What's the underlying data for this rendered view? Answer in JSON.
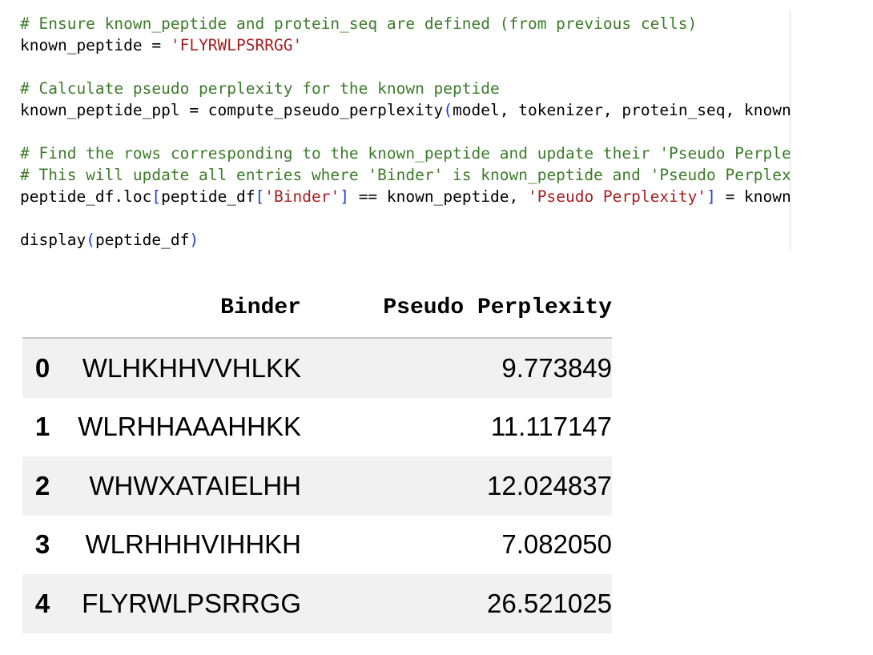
{
  "code_cell": {
    "lines": [
      [
        {
          "t": "# Ensure known_peptide and protein_seq are defined (from previous cells)",
          "c": "cm"
        }
      ],
      [
        {
          "t": "known_peptide = ",
          "c": ""
        },
        {
          "t": "'FLYRWLPSRRGG'",
          "c": "st"
        }
      ],
      [],
      [
        {
          "t": "# Calculate pseudo perplexity for the known peptide",
          "c": "cm"
        }
      ],
      [
        {
          "t": "known_peptide_ppl = compute_pseudo_perplexity",
          "c": ""
        },
        {
          "t": "(",
          "c": "pb"
        },
        {
          "t": "model, tokenizer, protein_seq, known_pept",
          "c": ""
        }
      ],
      [],
      [
        {
          "t": "# Find the rows corresponding to the known_peptide and update their 'Pseudo Perplexity'",
          "c": "cm"
        }
      ],
      [
        {
          "t": "# This will update all entries where 'Binder' is known_peptide and 'Pseudo Perplexity'",
          "c": "cm"
        }
      ],
      [
        {
          "t": "peptide_df.loc",
          "c": ""
        },
        {
          "t": "[",
          "c": "pb"
        },
        {
          "t": "peptide_df",
          "c": ""
        },
        {
          "t": "[",
          "c": "pb"
        },
        {
          "t": "'Binder'",
          "c": "st"
        },
        {
          "t": "]",
          "c": "pb"
        },
        {
          "t": " == known_peptide, ",
          "c": ""
        },
        {
          "t": "'Pseudo Perplexity'",
          "c": "st"
        },
        {
          "t": "]",
          "c": "pb"
        },
        {
          "t": " = known_pept",
          "c": ""
        }
      ],
      [],
      [
        {
          "t": "display",
          "c": ""
        },
        {
          "t": "(",
          "c": "pb"
        },
        {
          "t": "peptide_df",
          "c": ""
        },
        {
          "t": ")",
          "c": "pb"
        }
      ]
    ]
  },
  "dataframe": {
    "columns": [
      "",
      "Binder",
      "Pseudo Perplexity"
    ],
    "rows": [
      {
        "index": "0",
        "binder": "WLHKHHVVHLKK",
        "ppl": "9.773849"
      },
      {
        "index": "1",
        "binder": "WLRHHAAAHHKK",
        "ppl": "11.117147"
      },
      {
        "index": "2",
        "binder": "WHWXATAIELHH",
        "ppl": "12.024837"
      },
      {
        "index": "3",
        "binder": "WLRHHHVIHHKH",
        "ppl": "7.082050"
      },
      {
        "index": "4",
        "binder": "FLYRWLPSRRGG",
        "ppl": "26.521025"
      }
    ]
  },
  "colors": {
    "comment": "#3c7b2a",
    "string": "#a32020",
    "bracket": "#1d3fd6",
    "row_stripe": "#f1f1f1"
  }
}
